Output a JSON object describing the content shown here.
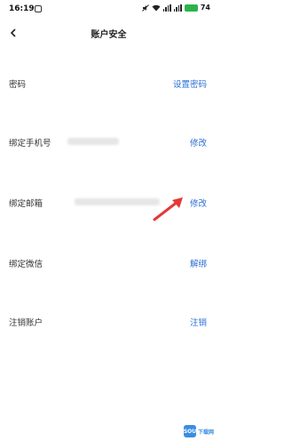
{
  "status_bar": {
    "time": "16:19",
    "battery_level": "74"
  },
  "header": {
    "title": "账户安全"
  },
  "rows": [
    {
      "label": "密码",
      "action": "设置密码"
    },
    {
      "label": "绑定手机号",
      "action": "修改"
    },
    {
      "label": "绑定邮箱",
      "action": "修改"
    },
    {
      "label": "绑定微信",
      "action": "解绑"
    },
    {
      "label": "注销账户",
      "action": "注销"
    }
  ],
  "annotation": {
    "arrow_color": "#e53935",
    "arrow_target": "rows.2.action"
  },
  "colors": {
    "accent": "#2a6fd6",
    "battery": "#2bb34b"
  },
  "watermark": {
    "logo_text": "SOU",
    "text": "下载网"
  },
  "icons": [
    "back-arrow-icon",
    "signal-icon",
    "wifi-icon",
    "battery-icon",
    "mute-icon"
  ]
}
